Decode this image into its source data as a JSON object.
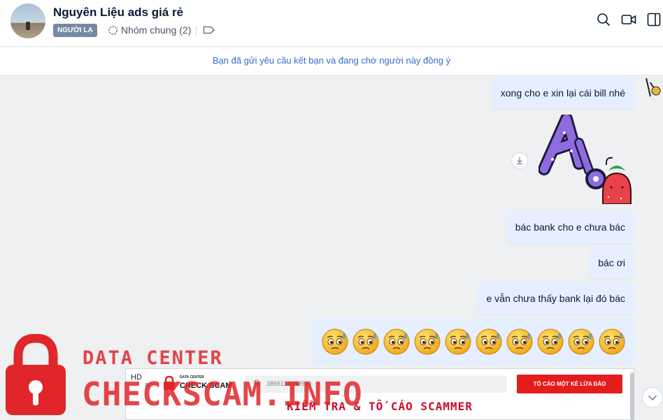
{
  "header": {
    "name": "Nguyên Liệu ads giá rẻ",
    "badge": "NGƯỜI LẠ",
    "group_label": "Nhóm chung (2)",
    "icons": [
      "search-icon",
      "video-call-icon",
      "sidebar-toggle-icon"
    ]
  },
  "friend_request": {
    "text": "Bạn đã gửi yêu cầu kết bạn và đang chờ người này đồng ý"
  },
  "messages": [
    {
      "text": "xong cho e xin lại cái bill nhé"
    },
    {
      "text": "bác bank cho e chưa bác"
    },
    {
      "text": "bác ơi"
    },
    {
      "text": "e vẫn chưa thấy bank lại đó bác"
    }
  ],
  "emoji_row": {
    "icon": "sweating-face-emoji",
    "count": 10
  },
  "watermark": {
    "line1": "DATA CENTER",
    "line2": "CHECKSCAM.INFO",
    "color": "#e0262a"
  },
  "embedded_site": {
    "quality": "HD",
    "brand_small": "DATA CENTER",
    "brand_big": "CHECK SCAM",
    "search_value": "3866119059999",
    "report_button": "TỐ CÁO MỘT KẺ LỪA ĐẢO",
    "tagline": "KIỂM TRA & TỐ CÁO SCAMMER"
  },
  "colors": {
    "bubble": "#e5efff",
    "chat_bg": "#eef0f1",
    "link": "#2f6fcf",
    "badge": "#7589a3"
  }
}
